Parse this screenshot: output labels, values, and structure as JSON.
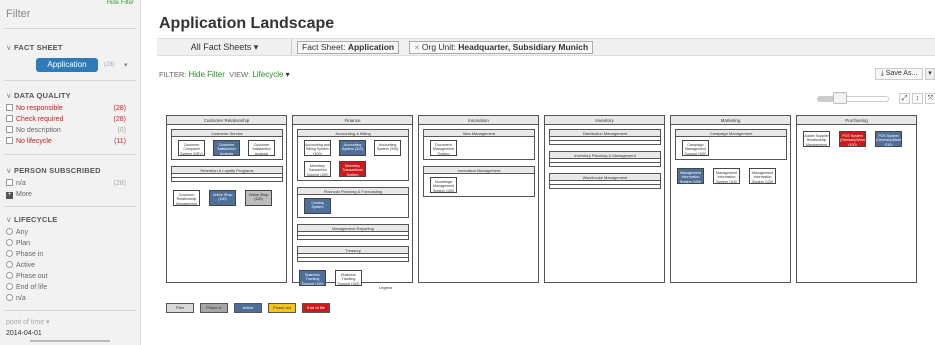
{
  "sidebar": {
    "filter_title": "Filter",
    "hide_filter_top": "Hide Filter",
    "fact_sheet": {
      "title": "FACT SHEET",
      "selected": "Application",
      "count": "(28)"
    },
    "data_quality": {
      "title": "DATA QUALITY",
      "items": [
        {
          "label": "No responsible",
          "count": "(28)"
        },
        {
          "label": "Check required",
          "count": "(28)"
        },
        {
          "label": "No description",
          "count": "(0)"
        },
        {
          "label": "No lifecycle",
          "count": "(11)"
        }
      ]
    },
    "person_subscribed": {
      "title": "PERSON SUBSCRIBED",
      "items": [
        {
          "label": "n/a",
          "count": "(28)"
        }
      ],
      "more": "More"
    },
    "lifecycle": {
      "title": "LIFECYCLE",
      "options": [
        "Any",
        "Plan",
        "Phase in",
        "Active",
        "Phase out",
        "End of life",
        "n/a"
      ]
    },
    "point_of_time": {
      "label": "point of time",
      "value": "2014-04-01"
    }
  },
  "main": {
    "title": "Application Landscape",
    "all_fact_sheets": "All Fact Sheets",
    "chip1": {
      "prefix": "Fact Sheet: ",
      "value": "Application"
    },
    "chip2": {
      "prefix": "Org Unit: ",
      "value": "Headquarter, Subsidiary Munich"
    },
    "filter_label": "FILTER:",
    "hide_filter": "Hide Filter",
    "view_label": "VIEW:",
    "view_value": "Lifecycle",
    "save_as": "Save As..."
  },
  "landscape": {
    "domains": [
      {
        "name": "Customer Relationship",
        "groups": [
          {
            "name": "Customer Service",
            "apps": [
              {
                "label": "Customer Complaint System (DEV)",
                "color": "white"
              },
              {
                "label": "Customer Satisfaction Analysis",
                "color": "blue"
              },
              {
                "label": "Customer Satisfaction Analysis",
                "color": "white"
              }
            ]
          },
          {
            "name": "Retention & Loyalty Programs",
            "apps": []
          }
        ],
        "loose_apps": [
          {
            "label": "Customer Relationship Management",
            "color": "white"
          },
          {
            "label": "Online Shop (100)",
            "color": "blue"
          },
          {
            "label": "Online Shop (120)",
            "color": "grey"
          }
        ]
      },
      {
        "name": "Finance",
        "groups": [
          {
            "name": "Accounting & Billing",
            "apps": [
              {
                "label": "Accounting and Billing System (100)",
                "color": "white"
              },
              {
                "label": "Accounting System (310)",
                "color": "blue"
              },
              {
                "label": "Accounting System (300)",
                "color": "white"
              },
              {
                "label": "Monetary Transaction Support (100)",
                "color": "white"
              },
              {
                "label": "Monetary Transactions System",
                "color": "red"
              }
            ]
          },
          {
            "name": "Financial Planning & Forecasting",
            "apps": [
              {
                "label": "Costing System",
                "color": "blue"
              }
            ]
          },
          {
            "name": "Management Reporting",
            "apps": []
          },
          {
            "name": "Treasury",
            "apps": []
          }
        ],
        "loose_apps": [
          {
            "label": "Business Tracking Support (100)",
            "color": "blue"
          },
          {
            "label": "Business Tracking Support (100)",
            "color": "white"
          }
        ]
      },
      {
        "name": "Innovation",
        "groups": [
          {
            "name": "Idea Management",
            "apps": [
              {
                "label": "Document Management System",
                "color": "white"
              }
            ]
          },
          {
            "name": "Innovation Management",
            "apps": [
              {
                "label": "Knowledge Management System (100)",
                "color": "white"
              }
            ]
          }
        ],
        "loose_apps": []
      },
      {
        "name": "Inventory",
        "groups": [
          {
            "name": "Distribution Management",
            "apps": []
          },
          {
            "name": "Inventory Planning & Management",
            "apps": []
          },
          {
            "name": "Warehouse Management",
            "apps": []
          }
        ],
        "loose_apps": []
      },
      {
        "name": "Marketing",
        "groups": [
          {
            "name": "Campaign Management",
            "apps": [
              {
                "label": "Campaign Management Support (100)",
                "color": "white"
              }
            ]
          }
        ],
        "loose_apps": [
          {
            "label": "Management Information System (100)",
            "color": "blue"
          },
          {
            "label": "Management Information System (110)",
            "color": "white"
          },
          {
            "label": "Management Information System (120)",
            "color": "white"
          }
        ]
      },
      {
        "name": "Purchasing",
        "groups": [],
        "loose_apps": [
          {
            "label": "Adobe Supplier Relationship Management",
            "color": "white"
          },
          {
            "label": "POS System (Germany/Munich) (100)",
            "color": "red"
          },
          {
            "label": "POS System (Germany/Munich) (110)",
            "color": "blue"
          }
        ]
      }
    ],
    "legend": {
      "title": "Legend",
      "items": [
        {
          "label": "Plan",
          "color": "#d9d9d9"
        },
        {
          "label": "Phase in",
          "color": "#a6a6a6"
        },
        {
          "label": "Active",
          "color": "#4d6f9a"
        },
        {
          "label": "Phase out",
          "color": "#f5c518"
        },
        {
          "label": "End of life",
          "color": "#cc1a1a"
        }
      ]
    }
  }
}
